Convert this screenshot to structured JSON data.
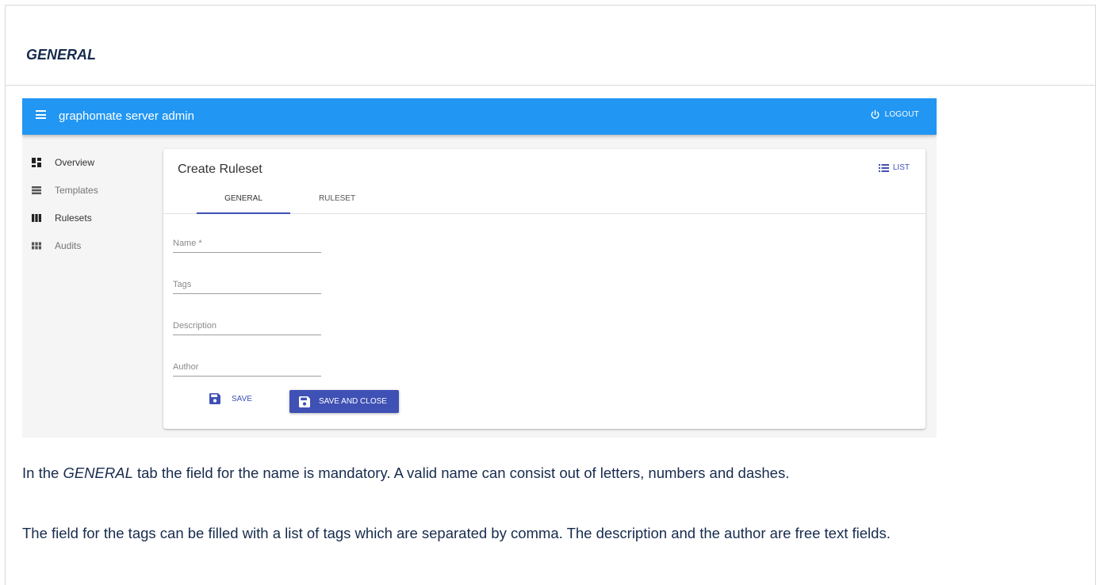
{
  "doc": {
    "heading": "GENERAL",
    "paragraph1_em": "GENERAL",
    "paragraph1_before": "In the ",
    "paragraph1_after": " tab the field for the name is mandatory. A valid name can consist out of letters, numbers and dashes.",
    "paragraph2": "The field for the tags can be filled with a list of tags which are separated by comma. The description and the author are free text fields."
  },
  "app": {
    "title": "graphomate server admin",
    "logout_label": "LOGOUT",
    "primary_color": "#2196f3",
    "accent_color": "#3f51b5"
  },
  "sidebar": {
    "items": [
      {
        "label": "Overview",
        "icon": "dashboard-icon"
      },
      {
        "label": "Templates",
        "icon": "list-view-icon"
      },
      {
        "label": "Rulesets",
        "icon": "column-view-icon"
      },
      {
        "label": "Audits",
        "icon": "module-view-icon"
      }
    ]
  },
  "card": {
    "title": "Create Ruleset",
    "list_label": "LIST",
    "tabs": [
      {
        "label": "GENERAL",
        "active": true
      },
      {
        "label": "RULESET",
        "active": false
      }
    ],
    "fields": [
      {
        "placeholder": "Name *",
        "value": ""
      },
      {
        "placeholder": "Tags",
        "value": ""
      },
      {
        "placeholder": "Description",
        "value": ""
      },
      {
        "placeholder": "Author",
        "value": ""
      }
    ],
    "save_label": "SAVE",
    "save_close_label": "SAVE AND CLOSE"
  }
}
